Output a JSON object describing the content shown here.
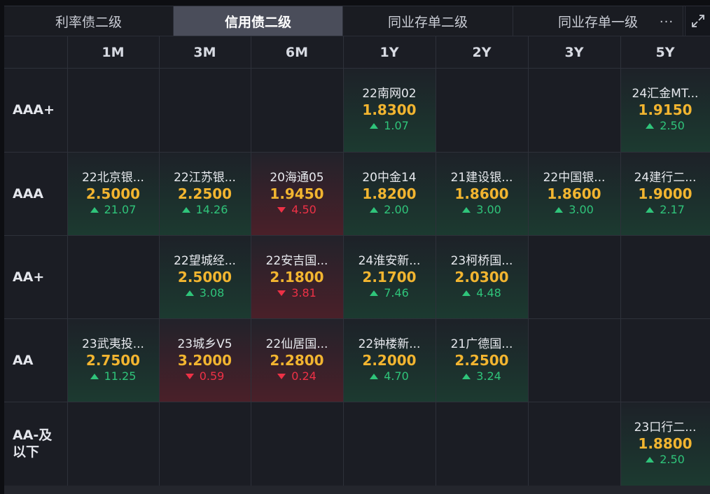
{
  "tabs": [
    {
      "label": "利率债二级",
      "active": false
    },
    {
      "label": "信用债二级",
      "active": true
    },
    {
      "label": "同业存单二级",
      "active": false
    },
    {
      "label": "同业存单一级",
      "active": false
    }
  ],
  "toolbar": {
    "more_label": "···",
    "expand_icon": "expand-icon"
  },
  "columns": [
    "1M",
    "3M",
    "6M",
    "1Y",
    "2Y",
    "3Y",
    "5Y"
  ],
  "rows": [
    {
      "label": "AAA+",
      "cells": [
        null,
        null,
        null,
        {
          "name": "22南网02",
          "rate": "1.8300",
          "change": "1.07",
          "direction": "up"
        },
        null,
        null,
        {
          "name": "24汇金MT...",
          "rate": "1.9150",
          "change": "2.50",
          "direction": "up"
        }
      ]
    },
    {
      "label": "AAA",
      "cells": [
        {
          "name": "22北京银...",
          "rate": "2.5000",
          "change": "21.07",
          "direction": "up"
        },
        {
          "name": "22江苏银...",
          "rate": "2.2500",
          "change": "14.26",
          "direction": "up"
        },
        {
          "name": "20海通05",
          "rate": "1.9450",
          "change": "4.50",
          "direction": "down"
        },
        {
          "name": "20中金14",
          "rate": "1.8200",
          "change": "2.00",
          "direction": "up"
        },
        {
          "name": "21建设银...",
          "rate": "1.8600",
          "change": "3.00",
          "direction": "up"
        },
        {
          "name": "22中国银...",
          "rate": "1.8600",
          "change": "3.00",
          "direction": "up"
        },
        {
          "name": "24建行二...",
          "rate": "1.9000",
          "change": "2.17",
          "direction": "up"
        }
      ]
    },
    {
      "label": "AA+",
      "cells": [
        null,
        {
          "name": "22望城经...",
          "rate": "2.5000",
          "change": "3.08",
          "direction": "up"
        },
        {
          "name": "22安吉国...",
          "rate": "2.1800",
          "change": "3.81",
          "direction": "down"
        },
        {
          "name": "24淮安新...",
          "rate": "2.1700",
          "change": "7.46",
          "direction": "up"
        },
        {
          "name": "23柯桥国...",
          "rate": "2.0300",
          "change": "4.48",
          "direction": "up"
        },
        null,
        null
      ]
    },
    {
      "label": "AA",
      "cells": [
        {
          "name": "23武夷投...",
          "rate": "2.7500",
          "change": "11.25",
          "direction": "up"
        },
        {
          "name": "23城乡V5",
          "rate": "3.2000",
          "change": "0.59",
          "direction": "down"
        },
        {
          "name": "22仙居国...",
          "rate": "2.2800",
          "change": "0.24",
          "direction": "down"
        },
        {
          "name": "22钟楼新...",
          "rate": "2.2000",
          "change": "4.70",
          "direction": "up"
        },
        {
          "name": "21广德国...",
          "rate": "2.2500",
          "change": "3.24",
          "direction": "up"
        },
        null,
        null
      ]
    },
    {
      "label": "AA-及\n以下",
      "cells": [
        null,
        null,
        null,
        null,
        null,
        null,
        {
          "name": "23口行二...",
          "rate": "1.8800",
          "change": "2.50",
          "direction": "up"
        }
      ]
    }
  ],
  "colors": {
    "rate": "#f2b530",
    "up": "#2fc47a",
    "down": "#ee3146",
    "active_tab": "#4a4d5a"
  }
}
